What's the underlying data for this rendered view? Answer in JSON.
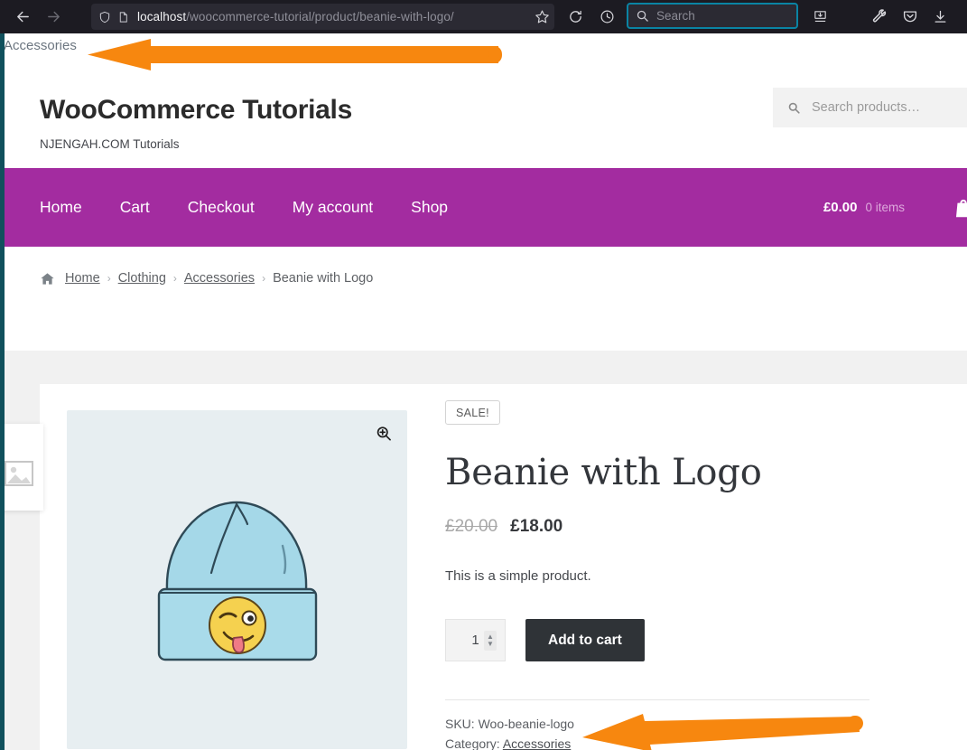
{
  "browser": {
    "back_icon": "arrow-left-icon",
    "forward_icon": "arrow-right-icon",
    "shield_icon": "shield-icon",
    "page_icon": "page-icon",
    "url_host": "localhost",
    "url_path": "/woocommerce-tutorial/product/beanie-with-logo/",
    "bookmark_icon": "star-icon",
    "reload_icon": "reload-icon",
    "history_icon": "clock-icon",
    "search_placeholder": "Search",
    "search_icon": "search-icon",
    "pocket_save_icon": "save-to-pocket-icon",
    "wrench_icon": "wrench-icon",
    "pocket_icon": "pocket-icon",
    "download_icon": "download-icon"
  },
  "page": {
    "stray_text": "Accessories",
    "header": {
      "site_title": "WooCommerce Tutorials",
      "tagline": "NJENGAH.COM Tutorials",
      "search_placeholder": "Search products…",
      "search_icon": "search-icon"
    },
    "nav": {
      "items": [
        {
          "label": "Home"
        },
        {
          "label": "Cart"
        },
        {
          "label": "Checkout"
        },
        {
          "label": "My account"
        },
        {
          "label": "Shop"
        }
      ],
      "cart_total": "£0.00",
      "cart_count": "0 items",
      "cart_icon": "shopping-cart-icon",
      "bar_color": "#a32ca0"
    },
    "breadcrumb": {
      "home_icon": "home-icon",
      "items": [
        {
          "label": "Home",
          "link": true
        },
        {
          "label": "Clothing",
          "link": true
        },
        {
          "label": "Accessories",
          "link": true
        },
        {
          "label": "Beanie with Logo",
          "link": false
        }
      ],
      "separator": "›"
    },
    "gallery": {
      "zoom_icon": "zoom-in-icon",
      "image_alt": "beanie-with-logo-illustration",
      "background_color": "#e7eef1"
    },
    "side_panel": {
      "thumb_icon": "image-placeholder-icon"
    },
    "product": {
      "sale_badge": "SALE!",
      "title": "Beanie with Logo",
      "price_old": "£20.00",
      "price_new": "£18.00",
      "short_description": "This is a simple product.",
      "quantity": "1",
      "quantity_up_icon": "chevron-up-icon",
      "quantity_down_icon": "chevron-down-icon",
      "add_to_cart_label": "Add to cart",
      "sku_label": "SKU:",
      "sku_value": "Woo-beanie-logo",
      "category_label": "Category:",
      "category_value": "Accessories"
    }
  },
  "annotations": {
    "color": "#f7870f",
    "arrows": [
      {
        "name": "arrow-to-page-title",
        "points_at": "Accessories"
      },
      {
        "name": "arrow-to-category-link",
        "points_at": "Accessories"
      }
    ]
  }
}
